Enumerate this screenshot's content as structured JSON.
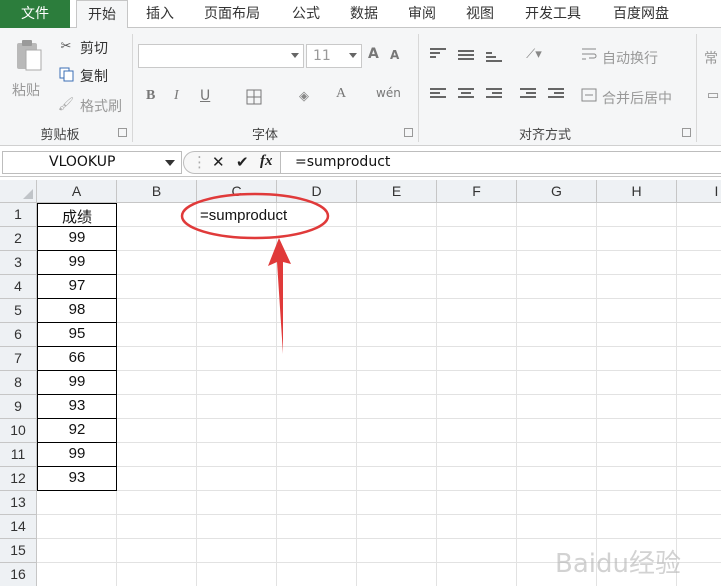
{
  "ribbon_tabs": [
    "文件",
    "开始",
    "插入",
    "页面布局",
    "公式",
    "数据",
    "审阅",
    "视图",
    "开发工具",
    "百度网盘"
  ],
  "clipboard": {
    "paste": "粘贴",
    "cut": "剪切",
    "copy": "复制",
    "format_painter": "格式刷",
    "label": "剪贴板"
  },
  "font": {
    "size": "11",
    "label": "字体",
    "grow": "A",
    "shrink": "A",
    "bold": "B",
    "italic": "I",
    "underline": "U",
    "font_color": "A",
    "phonetic": "wén"
  },
  "alignment": {
    "wrap_text": "自动换行",
    "merge_center": "合并后居中",
    "label": "对齐方式"
  },
  "number_group_partial": "常",
  "name_box": "VLOOKUP",
  "formula_bar": {
    "cancel": "✕",
    "enter": "✔",
    "fx": "fx",
    "value": "=sumproduct"
  },
  "columns": [
    "A",
    "B",
    "C",
    "D",
    "E",
    "F",
    "G",
    "H",
    "I"
  ],
  "rows": [
    "1",
    "2",
    "3",
    "4",
    "5",
    "6",
    "7",
    "8",
    "9",
    "10",
    "11",
    "12",
    "13",
    "14",
    "15",
    "16"
  ],
  "column_a": [
    "成绩",
    "99",
    "99",
    "97",
    "98",
    "95",
    "66",
    "99",
    "93",
    "92",
    "99",
    "93"
  ],
  "editing_cell_text": "=sumproduct",
  "annotation_color": "#e03a3a",
  "watermark": "Baidu经验"
}
